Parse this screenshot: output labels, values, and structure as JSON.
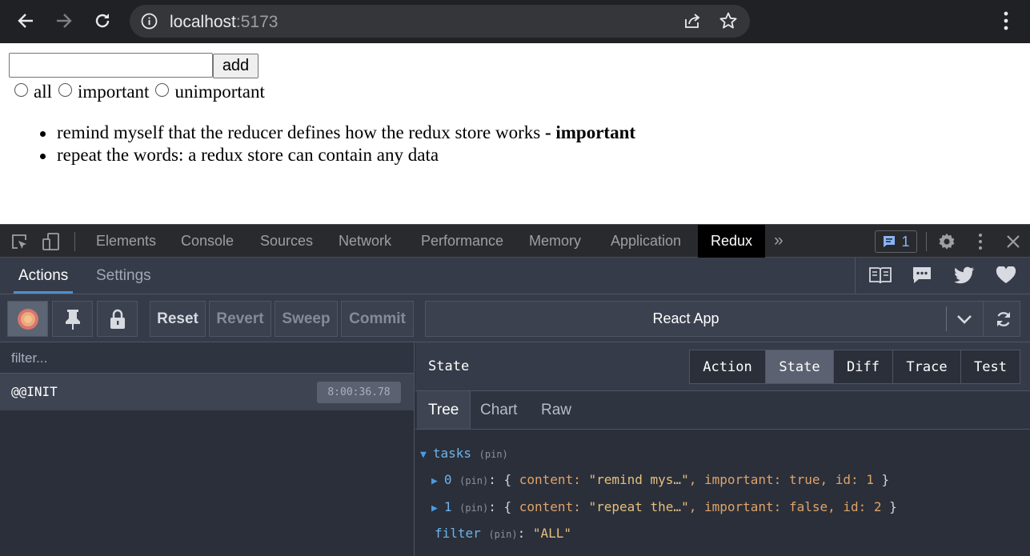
{
  "browser": {
    "url_host": "localhost",
    "url_port": ":5173"
  },
  "page": {
    "add_button": "add",
    "filters": [
      "all",
      "important",
      "unimportant"
    ],
    "tasks": [
      {
        "content": "remind myself that the reducer defines how the redux store works",
        "suffix": " - important"
      },
      {
        "content": "repeat the words: a redux store can contain any data",
        "suffix": ""
      }
    ]
  },
  "devtools": {
    "tabs": [
      "Elements",
      "Console",
      "Sources",
      "Network",
      "Performance",
      "Memory",
      "Application",
      "Redux"
    ],
    "active_tab": "Redux",
    "issues_count": "1"
  },
  "redux": {
    "tabs": [
      "Actions",
      "Settings"
    ],
    "toolbar": {
      "reset": "Reset",
      "revert": "Revert",
      "sweep": "Sweep",
      "commit": "Commit"
    },
    "instance_name": "React App",
    "filter_placeholder": "filter...",
    "actions": [
      {
        "name": "@@INIT",
        "time": "8:00:36.78"
      }
    ],
    "pane_title": "State",
    "modes": [
      "Action",
      "State",
      "Diff",
      "Trace",
      "Test"
    ],
    "active_mode": "State",
    "views": [
      "Tree",
      "Chart",
      "Raw"
    ],
    "active_view": "Tree",
    "tree": {
      "root_key": "tasks",
      "pin": "(pin)",
      "items": [
        {
          "index": "0",
          "content": "\"remind mys…\"",
          "important": "true",
          "id": "1"
        },
        {
          "index": "1",
          "content": "\"repeat the…\"",
          "important": "false",
          "id": "2"
        }
      ],
      "filter_key": "filter",
      "filter_value": "\"ALL\""
    }
  },
  "colors": {
    "chrome_bg": "#202124",
    "redux_bg": "#2a2f3a",
    "accent": "#4d8fce"
  }
}
